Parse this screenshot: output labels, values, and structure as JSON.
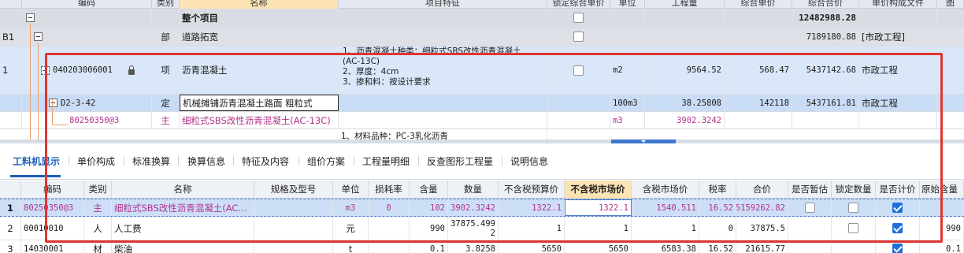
{
  "upper_grid": {
    "headers": [
      "编码",
      "类别",
      "名称",
      "项目特征",
      "锁定综合单价",
      "单位",
      "工程量",
      "综合单价",
      "综合合价",
      "单价构成文件"
    ],
    "total_row": {
      "name": "整个项目",
      "total": "12482988.28"
    },
    "section_row": {
      "seq": "B1",
      "type": "部",
      "name": "道路拓宽",
      "total": "7189180.88",
      "file": "[市政工程]"
    },
    "item_row": {
      "seq": "1",
      "code": "040203006001",
      "type": "项",
      "name": "沥青混凝土",
      "features": [
        "1、沥青混凝土种类：细粒式SBS改性沥青混凝土",
        "(AC-13C)",
        "2、厚度：4cm",
        "3、掺和料：按设计要求"
      ],
      "unit": "m2",
      "qty": "9564.52",
      "price": "568.47",
      "total": "5437142.68",
      "file": "市政工程"
    },
    "quota_row": {
      "code": "D2-3-42",
      "type": "定",
      "name": "机械摊铺沥青混凝土路面 粗粒式",
      "unit": "100m3",
      "qty": "38.25808",
      "price": "142118",
      "total": "5437161.81",
      "file": "市政工程"
    },
    "material_row": {
      "code": "80250350@3",
      "type": "主",
      "name": "细粒式SBS改性沥青混凝土(AC-13C)",
      "unit": "m3",
      "qty": "3902.3242"
    },
    "partial_row": {
      "feature": "1、材料品种：PC-3乳化沥青"
    }
  },
  "tabs": [
    "工料机显示",
    "单价构成",
    "标准换算",
    "换算信息",
    "特征及内容",
    "组价方案",
    "工程量明细",
    "反查图形工程量",
    "说明信息"
  ],
  "lower_grid": {
    "headers": [
      "编码",
      "类别",
      "名称",
      "规格及型号",
      "单位",
      "损耗率",
      "含量",
      "数量",
      "不含税预算价",
      "不含税市场价",
      "含税市场价",
      "税率",
      "合价",
      "是否暂估",
      "锁定数量",
      "是否计价",
      "原始含量"
    ],
    "rows": [
      {
        "seq": "1",
        "code": "80250350@3",
        "type": "主",
        "name": "细粒式SBS改性沥青混凝土(AC…",
        "spec": "",
        "unit": "m3",
        "loss": "0",
        "content": "102",
        "qty": "3902.3242",
        "budget": "1322.1",
        "market": "1322.1",
        "market_tax": "1540.511",
        "rate": "16.52",
        "total": "5159262.82",
        "temp": false,
        "lock": false,
        "priced": true,
        "orig": ""
      },
      {
        "seq": "2",
        "code": "00010010",
        "type": "人",
        "name": "人工费",
        "spec": "",
        "unit": "元",
        "loss": "",
        "content": "990",
        "qty": "37875.4992",
        "budget": "1",
        "market": "1",
        "market_tax": "1",
        "rate": "0",
        "total": "37875.5",
        "temp": false,
        "lock": false,
        "priced": true,
        "orig": "990"
      },
      {
        "seq": "3",
        "code": "14030001",
        "type": "材",
        "name": "柴油",
        "spec": "",
        "unit": "t",
        "loss": "",
        "content": "0.1",
        "qty": "3.8258",
        "budget": "5650",
        "market": "5650",
        "market_tax": "6583.38",
        "rate": "16.52",
        "total": "21615.77",
        "temp": false,
        "lock": false,
        "priced": true,
        "orig": "0.1"
      }
    ]
  },
  "colors": {
    "highlight": "#e0362f",
    "accent": "#1b5fb8",
    "material_text": "#b2328d"
  }
}
